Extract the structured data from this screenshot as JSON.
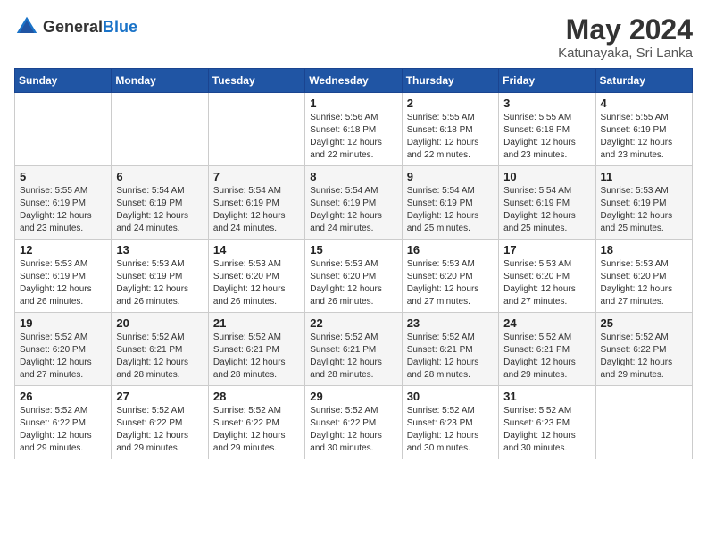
{
  "logo": {
    "general": "General",
    "blue": "Blue"
  },
  "title": "May 2024",
  "subtitle": "Katunayaka, Sri Lanka",
  "days_of_week": [
    "Sunday",
    "Monday",
    "Tuesday",
    "Wednesday",
    "Thursday",
    "Friday",
    "Saturday"
  ],
  "weeks": [
    [
      {
        "day": "",
        "info": ""
      },
      {
        "day": "",
        "info": ""
      },
      {
        "day": "",
        "info": ""
      },
      {
        "day": "1",
        "info": "Sunrise: 5:56 AM\nSunset: 6:18 PM\nDaylight: 12 hours and 22 minutes."
      },
      {
        "day": "2",
        "info": "Sunrise: 5:55 AM\nSunset: 6:18 PM\nDaylight: 12 hours and 22 minutes."
      },
      {
        "day": "3",
        "info": "Sunrise: 5:55 AM\nSunset: 6:18 PM\nDaylight: 12 hours and 23 minutes."
      },
      {
        "day": "4",
        "info": "Sunrise: 5:55 AM\nSunset: 6:19 PM\nDaylight: 12 hours and 23 minutes."
      }
    ],
    [
      {
        "day": "5",
        "info": "Sunrise: 5:55 AM\nSunset: 6:19 PM\nDaylight: 12 hours and 23 minutes."
      },
      {
        "day": "6",
        "info": "Sunrise: 5:54 AM\nSunset: 6:19 PM\nDaylight: 12 hours and 24 minutes."
      },
      {
        "day": "7",
        "info": "Sunrise: 5:54 AM\nSunset: 6:19 PM\nDaylight: 12 hours and 24 minutes."
      },
      {
        "day": "8",
        "info": "Sunrise: 5:54 AM\nSunset: 6:19 PM\nDaylight: 12 hours and 24 minutes."
      },
      {
        "day": "9",
        "info": "Sunrise: 5:54 AM\nSunset: 6:19 PM\nDaylight: 12 hours and 25 minutes."
      },
      {
        "day": "10",
        "info": "Sunrise: 5:54 AM\nSunset: 6:19 PM\nDaylight: 12 hours and 25 minutes."
      },
      {
        "day": "11",
        "info": "Sunrise: 5:53 AM\nSunset: 6:19 PM\nDaylight: 12 hours and 25 minutes."
      }
    ],
    [
      {
        "day": "12",
        "info": "Sunrise: 5:53 AM\nSunset: 6:19 PM\nDaylight: 12 hours and 26 minutes."
      },
      {
        "day": "13",
        "info": "Sunrise: 5:53 AM\nSunset: 6:19 PM\nDaylight: 12 hours and 26 minutes."
      },
      {
        "day": "14",
        "info": "Sunrise: 5:53 AM\nSunset: 6:20 PM\nDaylight: 12 hours and 26 minutes."
      },
      {
        "day": "15",
        "info": "Sunrise: 5:53 AM\nSunset: 6:20 PM\nDaylight: 12 hours and 26 minutes."
      },
      {
        "day": "16",
        "info": "Sunrise: 5:53 AM\nSunset: 6:20 PM\nDaylight: 12 hours and 27 minutes."
      },
      {
        "day": "17",
        "info": "Sunrise: 5:53 AM\nSunset: 6:20 PM\nDaylight: 12 hours and 27 minutes."
      },
      {
        "day": "18",
        "info": "Sunrise: 5:53 AM\nSunset: 6:20 PM\nDaylight: 12 hours and 27 minutes."
      }
    ],
    [
      {
        "day": "19",
        "info": "Sunrise: 5:52 AM\nSunset: 6:20 PM\nDaylight: 12 hours and 27 minutes."
      },
      {
        "day": "20",
        "info": "Sunrise: 5:52 AM\nSunset: 6:21 PM\nDaylight: 12 hours and 28 minutes."
      },
      {
        "day": "21",
        "info": "Sunrise: 5:52 AM\nSunset: 6:21 PM\nDaylight: 12 hours and 28 minutes."
      },
      {
        "day": "22",
        "info": "Sunrise: 5:52 AM\nSunset: 6:21 PM\nDaylight: 12 hours and 28 minutes."
      },
      {
        "day": "23",
        "info": "Sunrise: 5:52 AM\nSunset: 6:21 PM\nDaylight: 12 hours and 28 minutes."
      },
      {
        "day": "24",
        "info": "Sunrise: 5:52 AM\nSunset: 6:21 PM\nDaylight: 12 hours and 29 minutes."
      },
      {
        "day": "25",
        "info": "Sunrise: 5:52 AM\nSunset: 6:22 PM\nDaylight: 12 hours and 29 minutes."
      }
    ],
    [
      {
        "day": "26",
        "info": "Sunrise: 5:52 AM\nSunset: 6:22 PM\nDaylight: 12 hours and 29 minutes."
      },
      {
        "day": "27",
        "info": "Sunrise: 5:52 AM\nSunset: 6:22 PM\nDaylight: 12 hours and 29 minutes."
      },
      {
        "day": "28",
        "info": "Sunrise: 5:52 AM\nSunset: 6:22 PM\nDaylight: 12 hours and 29 minutes."
      },
      {
        "day": "29",
        "info": "Sunrise: 5:52 AM\nSunset: 6:22 PM\nDaylight: 12 hours and 30 minutes."
      },
      {
        "day": "30",
        "info": "Sunrise: 5:52 AM\nSunset: 6:23 PM\nDaylight: 12 hours and 30 minutes."
      },
      {
        "day": "31",
        "info": "Sunrise: 5:52 AM\nSunset: 6:23 PM\nDaylight: 12 hours and 30 minutes."
      },
      {
        "day": "",
        "info": ""
      }
    ]
  ]
}
